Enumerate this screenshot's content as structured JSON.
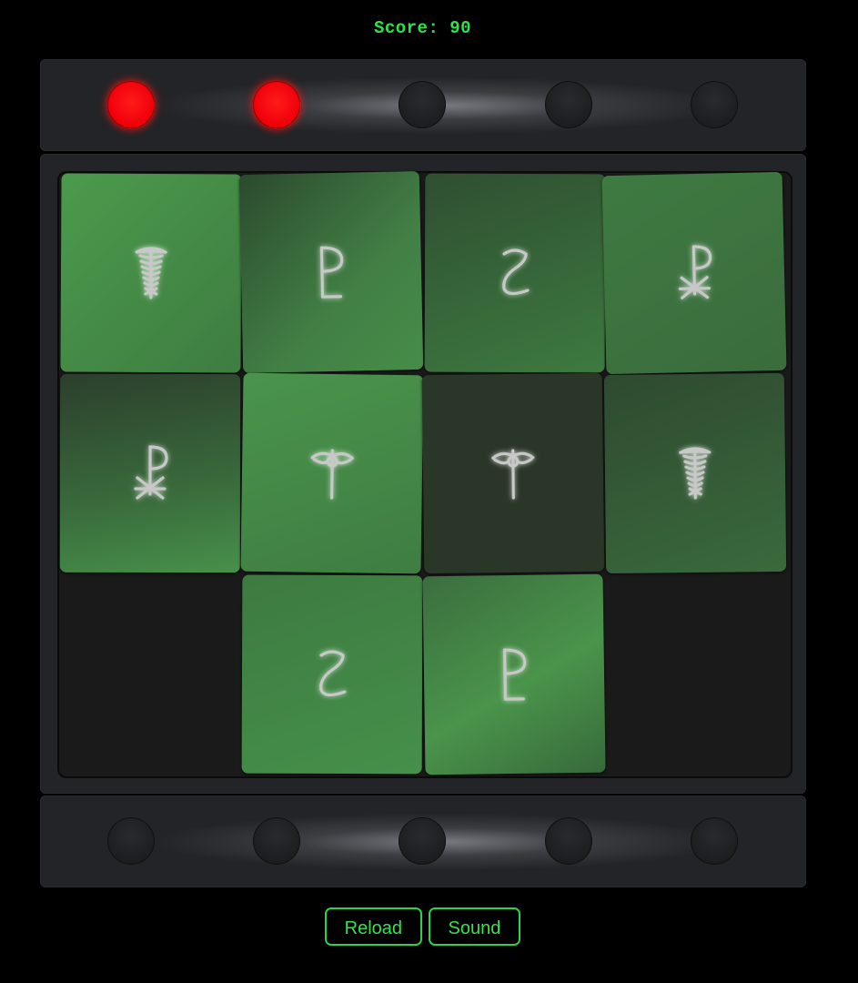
{
  "score_label": "Score: 90",
  "top_lights": [
    true,
    true,
    false,
    false,
    false
  ],
  "bottom_lights": [
    false,
    false,
    false,
    false,
    false
  ],
  "cards": [
    {
      "symbol": "caduceus-icon"
    },
    {
      "symbol": "rho-cross-icon"
    },
    {
      "symbol": "z-glyph-icon"
    },
    {
      "symbol": "chi-rho-icon"
    },
    {
      "symbol": "chi-rho-icon"
    },
    {
      "symbol": "staff-icon"
    },
    {
      "symbol": "staff-icon"
    },
    {
      "symbol": "caduceus-icon"
    },
    {
      "symbol": "z-glyph-icon"
    },
    {
      "symbol": "rho-cross-icon"
    }
  ],
  "buttons": {
    "reload": "Reload",
    "sound": "Sound"
  },
  "colors": {
    "accent_green": "#2fe24a",
    "light_on": "#ff1a1a",
    "card_green": "#469148"
  }
}
